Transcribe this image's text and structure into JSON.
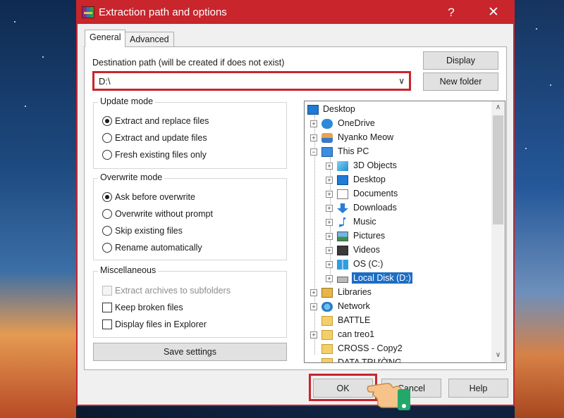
{
  "window": {
    "title": "Extraction path and options",
    "help_glyph": "?",
    "close_glyph": "✕"
  },
  "tabs": [
    {
      "label": "General",
      "active": true
    },
    {
      "label": "Advanced",
      "active": false
    }
  ],
  "destination": {
    "label": "Destination path (will be created if does not exist)",
    "value": "D:\\",
    "dropdown_glyph": "∨"
  },
  "buttons": {
    "display": "Display",
    "new_folder": "New folder",
    "save_settings": "Save settings",
    "ok": "OK",
    "cancel": "Cancel",
    "help": "Help"
  },
  "update_mode": {
    "title": "Update mode",
    "options": [
      {
        "label": "Extract and replace files",
        "selected": true
      },
      {
        "label": "Extract and update files",
        "selected": false
      },
      {
        "label": "Fresh existing files only",
        "selected": false
      }
    ]
  },
  "overwrite_mode": {
    "title": "Overwrite mode",
    "options": [
      {
        "label": "Ask before overwrite",
        "selected": true
      },
      {
        "label": "Overwrite without prompt",
        "selected": false
      },
      {
        "label": "Skip existing files",
        "selected": false
      },
      {
        "label": "Rename automatically",
        "selected": false
      }
    ]
  },
  "miscellaneous": {
    "title": "Miscellaneous",
    "options": [
      {
        "label": "Extract archives to subfolders",
        "checked": false,
        "disabled": true
      },
      {
        "label": "Keep broken files",
        "checked": false,
        "disabled": false
      },
      {
        "label": "Display files in Explorer",
        "checked": false,
        "disabled": false
      }
    ]
  },
  "tree": [
    {
      "label": "Desktop",
      "icon": "desktop-icon",
      "level": 0,
      "expander": ""
    },
    {
      "label": "OneDrive",
      "icon": "cloud-icon",
      "level": 1,
      "expander": "+"
    },
    {
      "label": "Nyanko Meow",
      "icon": "user-icon",
      "level": 1,
      "expander": "+"
    },
    {
      "label": "This PC",
      "icon": "computer-icon",
      "level": 1,
      "expander": "−"
    },
    {
      "label": "3D Objects",
      "icon": "cube-icon",
      "level": 2,
      "expander": "+"
    },
    {
      "label": "Desktop",
      "icon": "desktop-icon",
      "level": 2,
      "expander": "+"
    },
    {
      "label": "Documents",
      "icon": "document-icon",
      "level": 2,
      "expander": "+"
    },
    {
      "label": "Downloads",
      "icon": "download-icon",
      "level": 2,
      "expander": "+"
    },
    {
      "label": "Music",
      "icon": "music-icon",
      "level": 2,
      "expander": "+"
    },
    {
      "label": "Pictures",
      "icon": "pictures-icon",
      "level": 2,
      "expander": "+"
    },
    {
      "label": "Videos",
      "icon": "video-icon",
      "level": 2,
      "expander": "+"
    },
    {
      "label": "OS (C:)",
      "icon": "windows-drive-icon",
      "level": 2,
      "expander": "+"
    },
    {
      "label": "Local Disk (D:)",
      "icon": "drive-icon",
      "level": 2,
      "expander": "+",
      "selected": true
    },
    {
      "label": "Libraries",
      "icon": "library-icon",
      "level": 1,
      "expander": "+"
    },
    {
      "label": "Network",
      "icon": "network-icon",
      "level": 1,
      "expander": "+"
    },
    {
      "label": "BATTLE",
      "icon": "folder-icon",
      "level": 1,
      "expander": ""
    },
    {
      "label": "can treo1",
      "icon": "folder-icon",
      "level": 1,
      "expander": "+"
    },
    {
      "label": "CROSS - Copy2",
      "icon": "folder-icon",
      "level": 1,
      "expander": ""
    },
    {
      "label": "DATA TRƯỜNG",
      "icon": "folder-icon",
      "level": 1,
      "expander": ""
    }
  ],
  "scroll": {
    "up_glyph": "∧",
    "down_glyph": "∨"
  },
  "colors": {
    "accent": "#c9252c",
    "selection": "#1b6dc4",
    "face": "#f0f0f0"
  }
}
